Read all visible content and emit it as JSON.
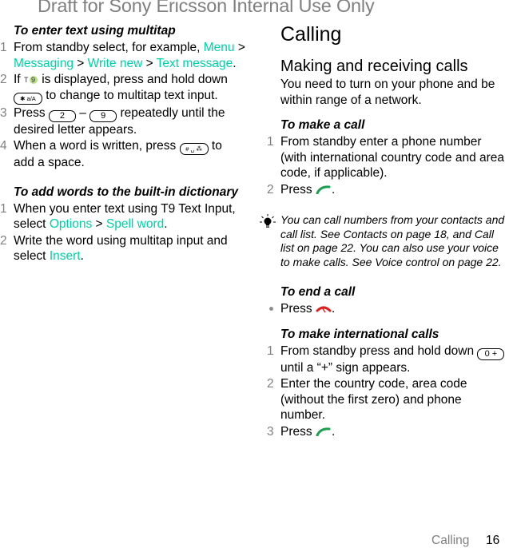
{
  "watermark": "Draft for Sony Ericsson Internal Use Only",
  "left": {
    "multitap": {
      "heading": "To enter text using multitap",
      "steps": [
        {
          "num": "1",
          "text_a": "From standby select, for example, ",
          "link1": "Menu",
          "sep1": " > ",
          "link2": "Messaging",
          "sep2": " > ",
          "link3": "Write new",
          "sep3": " > ",
          "link4": "Text message",
          "end": "."
        },
        {
          "num": "2",
          "text_a": "If ",
          "icon": "t9-icon",
          "text_b": " is displayed, press and hold down ",
          "key": "✱ a/A",
          "text_c": " to change to multitap text input."
        },
        {
          "num": "3",
          "text_a": "Press ",
          "key1": "2",
          "dash": " – ",
          "key2": "9",
          "text_b": " repeatedly until the desired letter appears."
        },
        {
          "num": "4",
          "text_a": "When a word is written, press ",
          "key": "# ␣ ⁂",
          "text_b": " to add a space."
        }
      ]
    },
    "dictionary": {
      "heading": "To add words to the built-in dictionary",
      "steps": [
        {
          "num": "1",
          "text_a": "When you enter text using T9 Text Input, select ",
          "link1": "Options",
          "sep1": " > ",
          "link2": "Spell word",
          "end": "."
        },
        {
          "num": "2",
          "text_a": "Write the word using multitap input and select ",
          "link1": "Insert",
          "end": "."
        }
      ]
    }
  },
  "right": {
    "title": "Calling",
    "section": "Making and receiving calls",
    "intro": "You need to turn on your phone and be within range of a network.",
    "make_call": {
      "heading": "To make a call",
      "steps": [
        {
          "num": "1",
          "text": "From standby enter a phone number (with international country code and area code, if applicable)."
        },
        {
          "num": "2",
          "text_a": "Press ",
          "icon": "call-icon",
          "end": "."
        }
      ]
    },
    "tip": "You can call numbers from your contacts and call list. See Contacts on page 18, and Call list on page 22. You can also use your voice to make calls. See Voice control on page 22.",
    "end_call": {
      "heading": "To end a call",
      "text_a": "Press ",
      "icon": "end-call-icon",
      "end": "."
    },
    "international": {
      "heading": "To make international calls",
      "steps": [
        {
          "num": "1",
          "text_a": "From standby press and hold down ",
          "key": "0 +",
          "text_b": " until a “+” sign appears."
        },
        {
          "num": "2",
          "text": "Enter the country code, area code (without the first zero) and phone number."
        },
        {
          "num": "3",
          "text_a": "Press ",
          "icon": "call-icon",
          "end": "."
        }
      ]
    }
  },
  "footer": {
    "section": "Calling",
    "page": "16"
  },
  "colors": {
    "link": "#00d0a8",
    "call_green": "#1aa050",
    "end_red": "#e02020",
    "step_number": "#808080"
  }
}
